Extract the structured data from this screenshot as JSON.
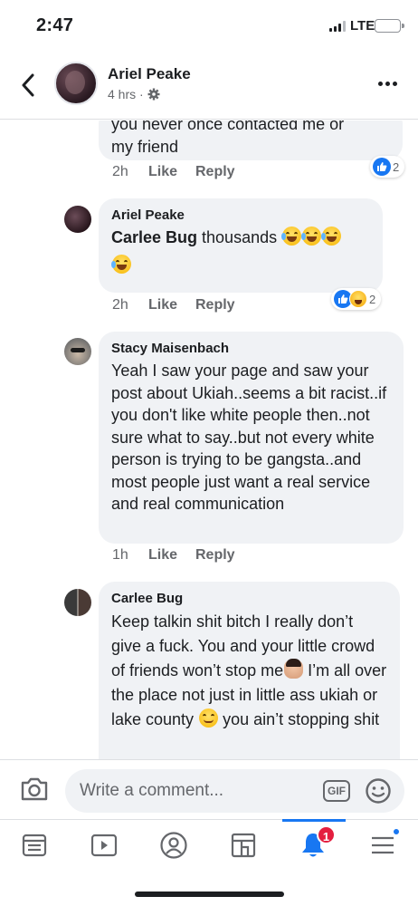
{
  "status_bar": {
    "time": "2:47",
    "network": "LTE"
  },
  "header": {
    "name": "Ariel Peake",
    "meta": "4 hrs ·",
    "back_icon": "chevron-left-icon",
    "privacy_icon": "gear-icon",
    "more_icon": "ellipsis-icon"
  },
  "comments": [
    {
      "text_partial": "you never once contacted me or",
      "text_line2": "my friend",
      "time": "2h",
      "like": "Like",
      "reply": "Reply",
      "reaction_count": "2"
    },
    {
      "author": "Ariel Peake",
      "mention": "Carlee Bug",
      "text": " thousands ",
      "time": "2h",
      "like": "Like",
      "reply": "Reply",
      "reaction_count": "2"
    },
    {
      "author": "Stacy Maisenbach",
      "text": "Yeah I saw your page and saw your post about Ukiah..seems a bit racist..if you don't like white people then..not sure what to say..but not every white person is trying to be gangsta..and most people just want a real service and real communication",
      "time": "1h",
      "like": "Like",
      "reply": "Reply"
    },
    {
      "author": "Carlee Bug",
      "text_a": "Keep talkin shit bitch I really don’t give a fuck. You and your little crowd of friends won’t stop me",
      "text_b": "I’m all over the place not just in little ass ukiah or lake county ",
      "text_c": "you ain’t stopping shit"
    }
  ],
  "composer": {
    "placeholder": "Write a comment...",
    "gif_label": "GIF"
  },
  "tabbar": {
    "notifications_badge": "1",
    "active_tab": "notifications"
  },
  "colors": {
    "accent": "#1877f2",
    "bubble": "#f0f2f5",
    "badge": "#e41e3f",
    "secondary_text": "#65676b"
  }
}
